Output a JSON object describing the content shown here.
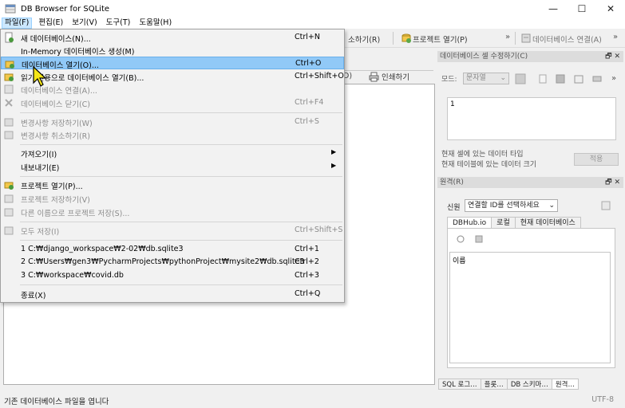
{
  "window": {
    "title": "DB Browser for SQLite",
    "minimize": "—",
    "maximize": "☐",
    "close": "✕"
  },
  "menubar": [
    {
      "label": "파일(F)"
    },
    {
      "label": "편집(E)"
    },
    {
      "label": "보기(V)"
    },
    {
      "label": "도구(T)"
    },
    {
      "label": "도움말(H)"
    }
  ],
  "toolbar": {
    "fragment": "소하기(R)",
    "open_project": "프로젝트 열기(P)",
    "more": "»",
    "attach_db": "데이터베이스 연결(A)",
    "more2": "»"
  },
  "main": {
    "tab_fragment": "D)",
    "print": "인쇄하기"
  },
  "cell_editor": {
    "title": "데이터베이스 셀 수정하기(C)",
    "mode_label": "모드:",
    "mode_value": "문자열",
    "value": "1",
    "type_label": "현재 셀에 있는 데이터 타입",
    "size_label": "현재 테이블에 있는 데이터 크기",
    "apply": "적용",
    "more": "»"
  },
  "remote": {
    "title": "원격(R)",
    "identity_label": "신원",
    "identity_placeholder": "연결할 ID를 선택하세요",
    "tabs": [
      "DBHub.io",
      "로컬",
      "현재 데이터베이스"
    ],
    "column_header": "이름"
  },
  "bottom_tabs": [
    "SQL 로그…",
    "플롯…",
    "DB 스키마…",
    "원격…"
  ],
  "dock_buttons": "🗗 ✕",
  "status": {
    "message": "기존 데이터베이스 파일을 엽니다",
    "encoding": "UTF-8"
  },
  "file_menu": [
    {
      "label": "새 데이터베이스(N)...",
      "shortcut": "Ctrl+N",
      "enabled": true,
      "icon": "new-db-icon"
    },
    {
      "label": "In-Memory 데이터베이스 생성(M)",
      "shortcut": "",
      "enabled": true,
      "icon": ""
    },
    {
      "label": "데이터베이스 열기(O)...",
      "shortcut": "Ctrl+O",
      "enabled": true,
      "icon": "open-db-icon",
      "highlighted": true
    },
    {
      "label": "읽기 전용으로 데이터베이스 열기(B)...",
      "shortcut": "Ctrl+Shift+O",
      "enabled": true,
      "icon": "open-readonly-icon"
    },
    {
      "label": "데이터베이스 연결(A)...",
      "shortcut": "",
      "enabled": false,
      "icon": "attach-db-icon"
    },
    {
      "label": "데이터베이스 닫기(C)",
      "shortcut": "Ctrl+F4",
      "enabled": false,
      "icon": "close-db-icon"
    },
    {
      "label": "변경사항 저장하기(W)",
      "shortcut": "Ctrl+S",
      "enabled": false,
      "icon": "write-changes-icon"
    },
    {
      "label": "변경사항 취소하기(R)",
      "shortcut": "",
      "enabled": false,
      "icon": "revert-changes-icon"
    },
    {
      "label": "가져오기(I)",
      "shortcut": "",
      "enabled": true,
      "icon": "",
      "submenu": true
    },
    {
      "label": "내보내기(E)",
      "shortcut": "",
      "enabled": true,
      "icon": "",
      "submenu": true
    },
    {
      "label": "프로젝트 열기(P)...",
      "shortcut": "",
      "enabled": true,
      "icon": "open-project-icon"
    },
    {
      "label": "프로젝트 저장하기(V)",
      "shortcut": "",
      "enabled": false,
      "icon": "save-project-icon"
    },
    {
      "label": "다른 이름으로 프로젝트 저장(S)...",
      "shortcut": "",
      "enabled": false,
      "icon": "save-project-as-icon"
    },
    {
      "label": "모두 저장(I)",
      "shortcut": "Ctrl+Shift+S",
      "enabled": false,
      "icon": "save-all-icon"
    },
    {
      "label": "1 C:₩django_workspace₩2-02₩db.sqlite3",
      "shortcut": "Ctrl+1",
      "enabled": true,
      "icon": ""
    },
    {
      "label": "2 C:₩Users₩gen3₩PycharmProjects₩pythonProject₩mysite2₩db.sqlite3",
      "shortcut": "Ctrl+2",
      "enabled": true,
      "icon": ""
    },
    {
      "label": "3 C:₩workspace₩covid.db",
      "shortcut": "Ctrl+3",
      "enabled": true,
      "icon": ""
    },
    {
      "label": "종료(X)",
      "shortcut": "Ctrl+Q",
      "enabled": true,
      "icon": ""
    }
  ]
}
